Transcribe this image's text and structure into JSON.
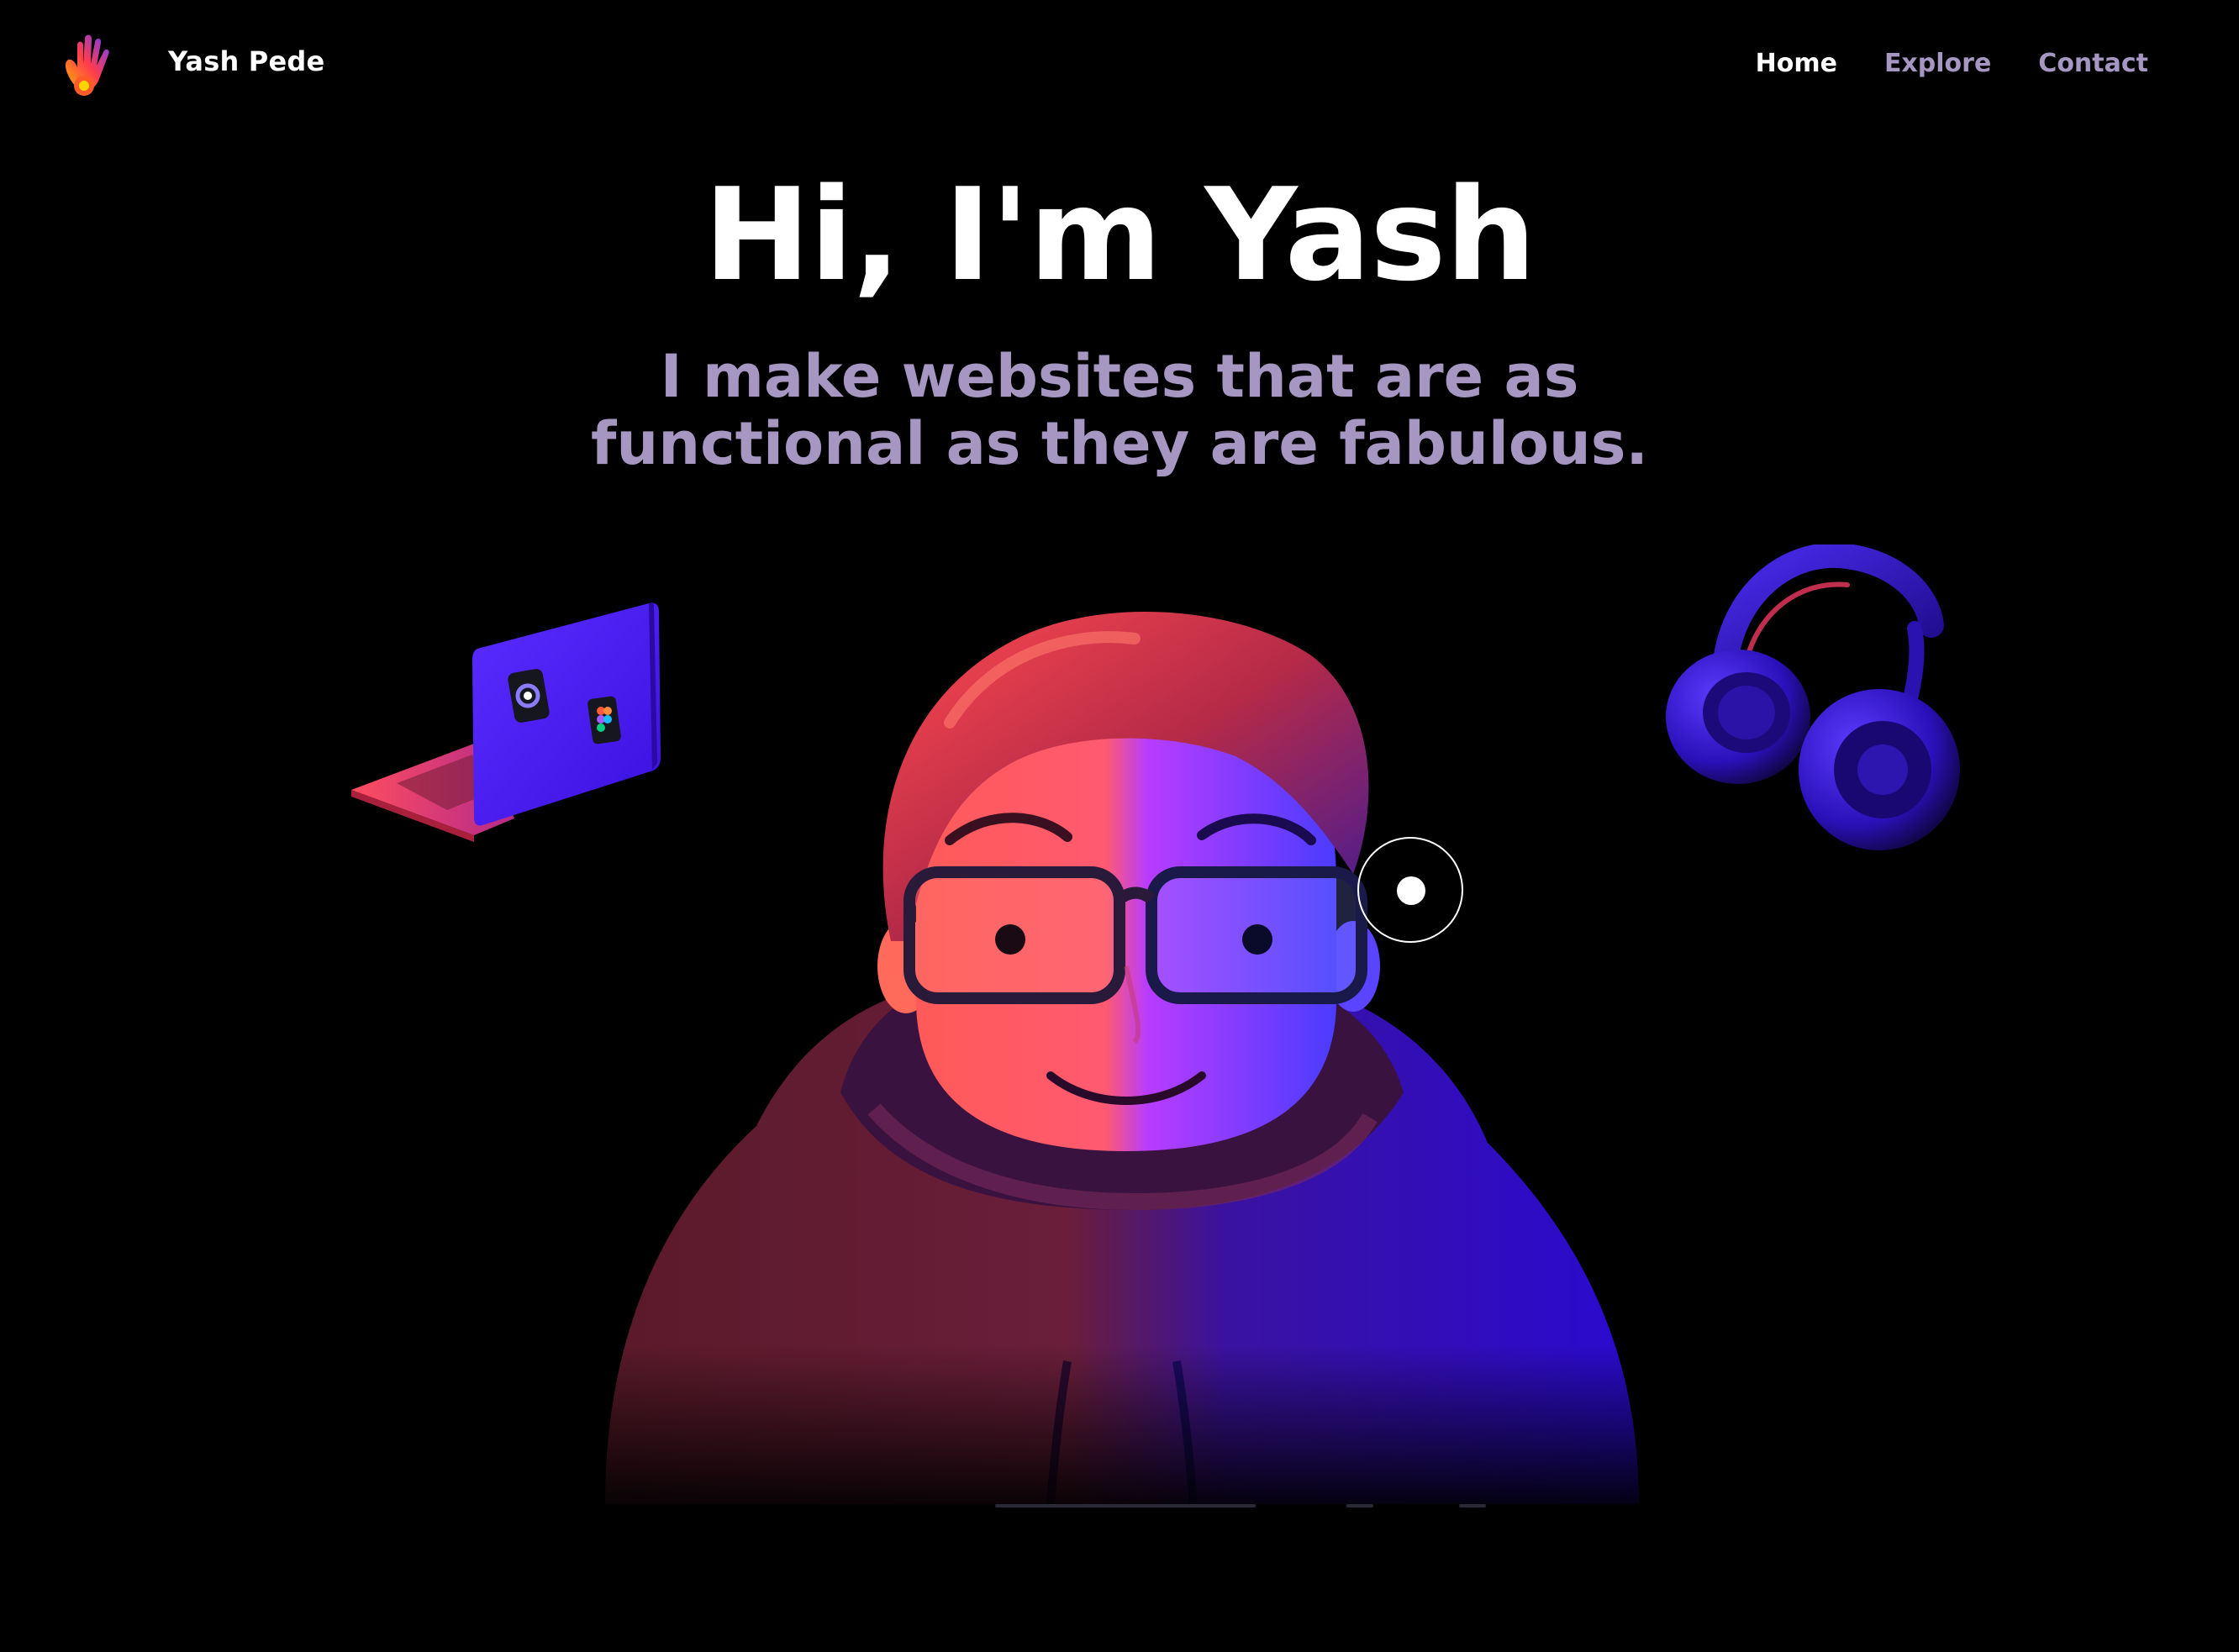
{
  "header": {
    "brand": "Yash Pede",
    "logo_icon": "waving-hand-icon",
    "nav": [
      {
        "label": "Home",
        "active": true
      },
      {
        "label": "Explore",
        "active": false
      },
      {
        "label": "Contact",
        "active": false
      }
    ]
  },
  "hero": {
    "title": "Hi, I'm Yash",
    "subtitle_line1": "I make websites that are as",
    "subtitle_line2": "functional as they are fabulous."
  },
  "illustrations": {
    "laptop_icon": "laptop-icon",
    "headphones_icon": "headphones-icon",
    "avatar": "3d-avatar-with-glasses-and-hoodie"
  },
  "colors": {
    "background": "#000000",
    "muted_purple": "#a596c2",
    "accent_blue": "#3a1dff",
    "accent_red": "#ff4a5a"
  }
}
